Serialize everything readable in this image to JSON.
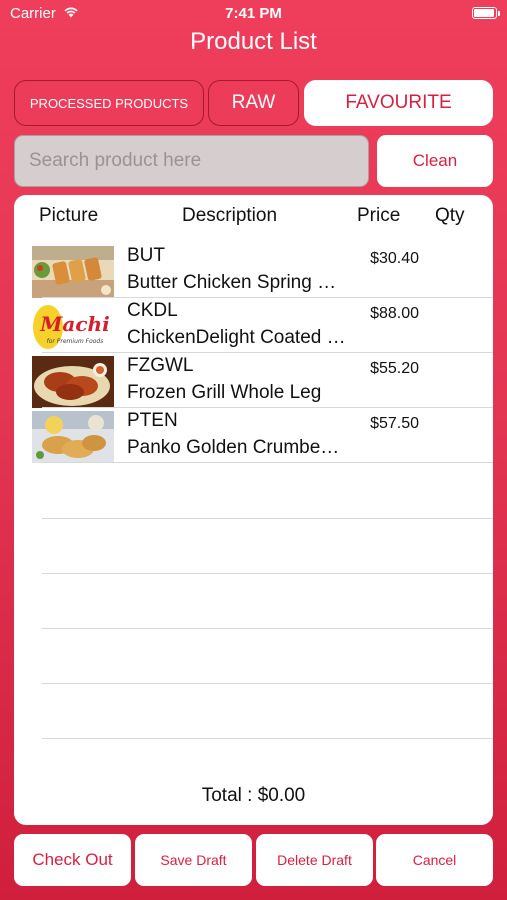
{
  "status_bar": {
    "carrier": "Carrier",
    "time": "7:41 PM",
    "battery_level": 0.95
  },
  "header": {
    "title": "Product List"
  },
  "tabs": [
    {
      "label": "PROCESSED PRODUCTS",
      "active": false
    },
    {
      "label": "RAW",
      "active": false
    },
    {
      "label": "FAVOURITE",
      "active": true
    }
  ],
  "search": {
    "placeholder": "Search product here",
    "value": "",
    "clean_label": "Clean"
  },
  "table": {
    "columns": [
      "Picture",
      "Description",
      "Price",
      "Qty"
    ],
    "rows": [
      {
        "code": "BUT",
        "description": "Butter Chicken Spring Rolls",
        "price": "$30.40",
        "image": "spring-rolls-photo"
      },
      {
        "code": "CKDL",
        "description": "ChickenDelight Coated Chicken",
        "price": "$88.00",
        "image": "machi-logo"
      },
      {
        "code": "FZGWL",
        "description": "Frozen Grill Whole Leg",
        "price": "$55.20",
        "image": "grilled-chicken-photo"
      },
      {
        "code": "PTEN",
        "description": "Panko Golden Crumbed Tenders",
        "price": "$57.50",
        "image": "crumbed-tenders-photo"
      }
    ],
    "machi_logo_text": "Machi",
    "machi_logo_tagline": "for Premium Foods"
  },
  "total": {
    "text": "Total : $0.00"
  },
  "footer": {
    "checkout": "Check Out",
    "save_draft": "Save Draft",
    "delete_draft": "Delete Draft",
    "cancel": "Cancel"
  },
  "colors": {
    "accent": "#d91f41",
    "background_top": "#ef3e5c",
    "background_bottom": "#cf1f3d"
  }
}
